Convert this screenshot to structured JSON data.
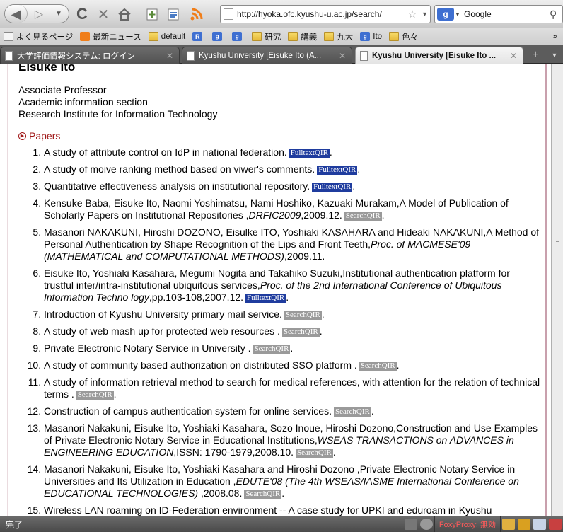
{
  "toolbar": {
    "url": "http://hyoka.ofc.kyushu-u.ac.jp/search/",
    "search_engine": "Google"
  },
  "bookmarks": [
    {
      "label": "よく見るページ",
      "icon": "box-icon"
    },
    {
      "label": "最新ニュース",
      "icon": "rss-icon"
    },
    {
      "label": "default",
      "icon": "folder-icon"
    },
    {
      "label": "",
      "icon": "r-icon"
    },
    {
      "label": "",
      "icon": "google-icon"
    },
    {
      "label": "",
      "icon": "google-icon"
    },
    {
      "label": "研究",
      "icon": "folder-icon"
    },
    {
      "label": "講義",
      "icon": "folder-icon"
    },
    {
      "label": "九大",
      "icon": "folder-icon"
    },
    {
      "label": "Ito",
      "icon": "google-icon"
    },
    {
      "label": "色々",
      "icon": "folder-icon"
    }
  ],
  "tabs": [
    {
      "label": "大学評価情報システム: ログイン",
      "active": false
    },
    {
      "label": "Kyushu University [Eisuke Ito (A...",
      "active": false
    },
    {
      "label": "Kyushu University [Eisuke Ito ...",
      "active": true
    }
  ],
  "profile": {
    "name": "Eisuke Ito",
    "affiliation": [
      "Associate Professor",
      "Academic information section",
      "Research Institute for Information Technology"
    ],
    "section_title": "Papers"
  },
  "papers": [
    {
      "text": "A study of attribute control on IdP in national federation.",
      "venue": "",
      "tail": "",
      "badge": "FulltextQIR",
      "badge_type": "full"
    },
    {
      "text": "A study of moive ranking method based on viwer's comments.",
      "venue": "",
      "tail": "",
      "badge": "FulltextQIR",
      "badge_type": "full"
    },
    {
      "text": "Quantitative effectiveness analysis on institutional repository.",
      "venue": "",
      "tail": "",
      "badge": "FulltextQIR",
      "badge_type": "full"
    },
    {
      "text": "Kensuke Baba, Eisuke Ito, Naomi Yoshimatsu, Nami Hoshiko, Kazuaki Murakam,A Model of Publication of Scholarly Papers on Institutional Repositories ,",
      "venue": "DRFIC2009",
      "tail": ",2009.12.",
      "badge": "SearchQIR",
      "badge_type": "search"
    },
    {
      "text": "Masanori NAKAKUNI, Hiroshi DOZONO, Eisulke ITO, Yoshiaki KASAHARA and Hideaki NAKAKUNI,A Method of Personal Authentication by Shape Recognition of the Lips and Front Teeth,",
      "venue": "Proc. of MACMESE'09 (MATHEMATICAL and COMPUTATIONAL METHODS)",
      "tail": ",2009.11.",
      "badge": "",
      "badge_type": ""
    },
    {
      "text": "Eisuke Ito, Yoshiaki Kasahara, Megumi Nogita and Takahiko Suzuki,Institutional authentication platform for trustful inter/intra-institutional ubiquitous services,",
      "venue": "Proc. of the 2nd International Conference of Ubiquitous Information Techno logy",
      "tail": ",pp.103-108,2007.12.",
      "badge": "FulltextQIR",
      "badge_type": "full"
    },
    {
      "text": "Introduction of Kyushu University primary mail service.",
      "venue": "",
      "tail": "",
      "badge": "SearchQIR",
      "badge_type": "search"
    },
    {
      "text": "A study of web mash up for protected web resources .",
      "venue": "",
      "tail": "",
      "badge": "SearchQIR",
      "badge_type": "search"
    },
    {
      "text": "Private Electronic Notary Service in University .",
      "venue": "",
      "tail": "",
      "badge": "SearchQIR",
      "badge_type": "search"
    },
    {
      "text": "A study of community based authorization on distributed SSO platform .",
      "venue": "",
      "tail": "",
      "badge": "SearchQIR",
      "badge_type": "search"
    },
    {
      "text": "A study of information retrieval method to search for medical references, with attention for the relation of technical terms .",
      "venue": "",
      "tail": "",
      "badge": "SearchQIR",
      "badge_type": "search"
    },
    {
      "text": "Construction of campus authentication system for online services.",
      "venue": "",
      "tail": "",
      "badge": "SearchQIR",
      "badge_type": "search"
    },
    {
      "text": "Masanori Nakakuni, Eisuke Ito, Yoshiaki Kasahara, Sozo Inoue, Hiroshi Dozono,Construction and Use Examples of Private Electronic Notary Service in Educational Institutions,",
      "venue": "WSEAS TRANSACTIONS on ADVANCES in ENGINEERING EDUCATION",
      "tail": ",ISSN: 1790-1979,2008.10.",
      "badge": "SearchQIR",
      "badge_type": "search"
    },
    {
      "text": "Masanori Nakakuni, Eisuke Ito, Yoshiaki Kasahara and Hiroshi Dozono ,Private Electronic Notary Service in Universities and Its Utilization in Education ,",
      "venue": "EDUTE'08 (The 4th WSEAS/IASME International Conference on EDUCATIONAL TECHNOLOGIES)",
      "tail": " ,2008.08.",
      "badge": "SearchQIR",
      "badge_type": "search"
    },
    {
      "text": "Wireless LAN roaming on ID-Federation environment -- A case study for UPKI and eduroam in Kyushu",
      "venue": "",
      "tail": "",
      "badge": "",
      "badge_type": ""
    }
  ],
  "status": {
    "text": "完了",
    "foxyproxy": "FoxyProxy: 無効"
  },
  "colors": {
    "section": "#a01818",
    "fulltext_badge": "#1f3c9e",
    "search_badge": "#9a9a9a"
  }
}
